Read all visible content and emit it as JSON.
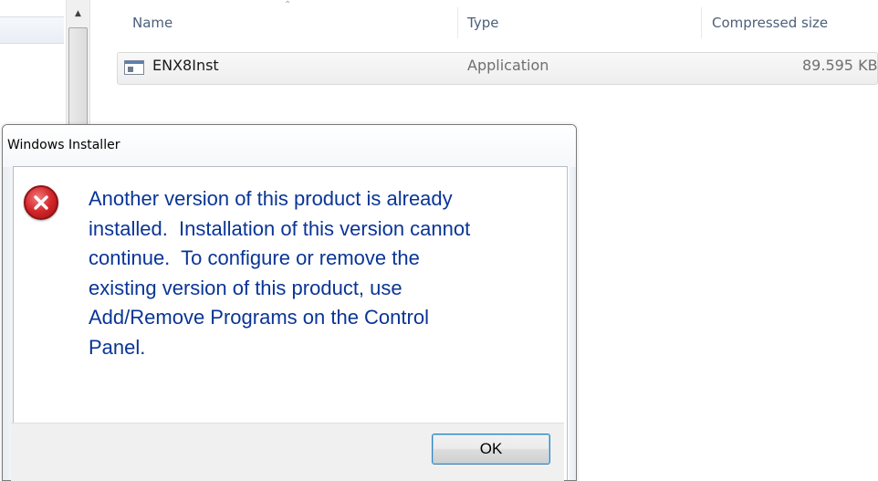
{
  "explorer": {
    "columns": [
      {
        "label": "Name"
      },
      {
        "label": "Type"
      },
      {
        "label": "Compressed size"
      }
    ],
    "rows": [
      {
        "icon": "application-icon",
        "name": "ENX8Inst",
        "type": "Application",
        "compressed_size": "89.595 KB"
      }
    ]
  },
  "dialog": {
    "title": "Windows Installer",
    "icon": "error-icon",
    "message_lines": [
      "Another version of this product is already",
      "installed.  Installation of this version cannot",
      "continue.  To configure or remove the",
      "existing version of this product, use",
      "Add/Remove Programs on the Control",
      "Panel."
    ],
    "ok_label": "OK"
  },
  "colors": {
    "message_text": "#0a3596",
    "error_red": "#d4262a",
    "button_focus_border": "#3c7fb1"
  }
}
